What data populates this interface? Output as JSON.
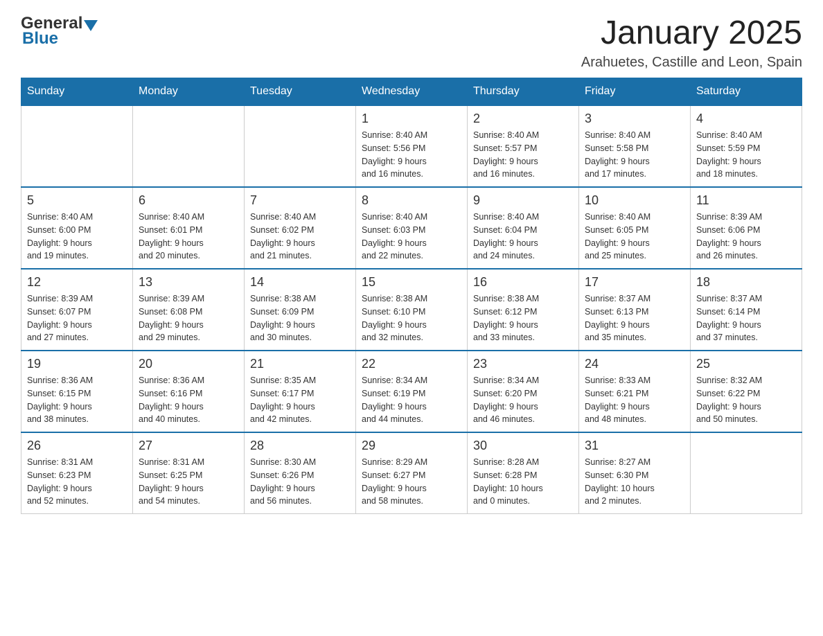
{
  "header": {
    "logo": {
      "general": "General",
      "blue": "Blue",
      "arrow_label": "logo-arrow"
    },
    "title": "January 2025",
    "subtitle": "Arahuetes, Castille and Leon, Spain"
  },
  "calendar": {
    "days_of_week": [
      "Sunday",
      "Monday",
      "Tuesday",
      "Wednesday",
      "Thursday",
      "Friday",
      "Saturday"
    ],
    "weeks": [
      [
        {
          "day": "",
          "info": ""
        },
        {
          "day": "",
          "info": ""
        },
        {
          "day": "",
          "info": ""
        },
        {
          "day": "1",
          "info": "Sunrise: 8:40 AM\nSunset: 5:56 PM\nDaylight: 9 hours\nand 16 minutes."
        },
        {
          "day": "2",
          "info": "Sunrise: 8:40 AM\nSunset: 5:57 PM\nDaylight: 9 hours\nand 16 minutes."
        },
        {
          "day": "3",
          "info": "Sunrise: 8:40 AM\nSunset: 5:58 PM\nDaylight: 9 hours\nand 17 minutes."
        },
        {
          "day": "4",
          "info": "Sunrise: 8:40 AM\nSunset: 5:59 PM\nDaylight: 9 hours\nand 18 minutes."
        }
      ],
      [
        {
          "day": "5",
          "info": "Sunrise: 8:40 AM\nSunset: 6:00 PM\nDaylight: 9 hours\nand 19 minutes."
        },
        {
          "day": "6",
          "info": "Sunrise: 8:40 AM\nSunset: 6:01 PM\nDaylight: 9 hours\nand 20 minutes."
        },
        {
          "day": "7",
          "info": "Sunrise: 8:40 AM\nSunset: 6:02 PM\nDaylight: 9 hours\nand 21 minutes."
        },
        {
          "day": "8",
          "info": "Sunrise: 8:40 AM\nSunset: 6:03 PM\nDaylight: 9 hours\nand 22 minutes."
        },
        {
          "day": "9",
          "info": "Sunrise: 8:40 AM\nSunset: 6:04 PM\nDaylight: 9 hours\nand 24 minutes."
        },
        {
          "day": "10",
          "info": "Sunrise: 8:40 AM\nSunset: 6:05 PM\nDaylight: 9 hours\nand 25 minutes."
        },
        {
          "day": "11",
          "info": "Sunrise: 8:39 AM\nSunset: 6:06 PM\nDaylight: 9 hours\nand 26 minutes."
        }
      ],
      [
        {
          "day": "12",
          "info": "Sunrise: 8:39 AM\nSunset: 6:07 PM\nDaylight: 9 hours\nand 27 minutes."
        },
        {
          "day": "13",
          "info": "Sunrise: 8:39 AM\nSunset: 6:08 PM\nDaylight: 9 hours\nand 29 minutes."
        },
        {
          "day": "14",
          "info": "Sunrise: 8:38 AM\nSunset: 6:09 PM\nDaylight: 9 hours\nand 30 minutes."
        },
        {
          "day": "15",
          "info": "Sunrise: 8:38 AM\nSunset: 6:10 PM\nDaylight: 9 hours\nand 32 minutes."
        },
        {
          "day": "16",
          "info": "Sunrise: 8:38 AM\nSunset: 6:12 PM\nDaylight: 9 hours\nand 33 minutes."
        },
        {
          "day": "17",
          "info": "Sunrise: 8:37 AM\nSunset: 6:13 PM\nDaylight: 9 hours\nand 35 minutes."
        },
        {
          "day": "18",
          "info": "Sunrise: 8:37 AM\nSunset: 6:14 PM\nDaylight: 9 hours\nand 37 minutes."
        }
      ],
      [
        {
          "day": "19",
          "info": "Sunrise: 8:36 AM\nSunset: 6:15 PM\nDaylight: 9 hours\nand 38 minutes."
        },
        {
          "day": "20",
          "info": "Sunrise: 8:36 AM\nSunset: 6:16 PM\nDaylight: 9 hours\nand 40 minutes."
        },
        {
          "day": "21",
          "info": "Sunrise: 8:35 AM\nSunset: 6:17 PM\nDaylight: 9 hours\nand 42 minutes."
        },
        {
          "day": "22",
          "info": "Sunrise: 8:34 AM\nSunset: 6:19 PM\nDaylight: 9 hours\nand 44 minutes."
        },
        {
          "day": "23",
          "info": "Sunrise: 8:34 AM\nSunset: 6:20 PM\nDaylight: 9 hours\nand 46 minutes."
        },
        {
          "day": "24",
          "info": "Sunrise: 8:33 AM\nSunset: 6:21 PM\nDaylight: 9 hours\nand 48 minutes."
        },
        {
          "day": "25",
          "info": "Sunrise: 8:32 AM\nSunset: 6:22 PM\nDaylight: 9 hours\nand 50 minutes."
        }
      ],
      [
        {
          "day": "26",
          "info": "Sunrise: 8:31 AM\nSunset: 6:23 PM\nDaylight: 9 hours\nand 52 minutes."
        },
        {
          "day": "27",
          "info": "Sunrise: 8:31 AM\nSunset: 6:25 PM\nDaylight: 9 hours\nand 54 minutes."
        },
        {
          "day": "28",
          "info": "Sunrise: 8:30 AM\nSunset: 6:26 PM\nDaylight: 9 hours\nand 56 minutes."
        },
        {
          "day": "29",
          "info": "Sunrise: 8:29 AM\nSunset: 6:27 PM\nDaylight: 9 hours\nand 58 minutes."
        },
        {
          "day": "30",
          "info": "Sunrise: 8:28 AM\nSunset: 6:28 PM\nDaylight: 10 hours\nand 0 minutes."
        },
        {
          "day": "31",
          "info": "Sunrise: 8:27 AM\nSunset: 6:30 PM\nDaylight: 10 hours\nand 2 minutes."
        },
        {
          "day": "",
          "info": ""
        }
      ]
    ]
  }
}
